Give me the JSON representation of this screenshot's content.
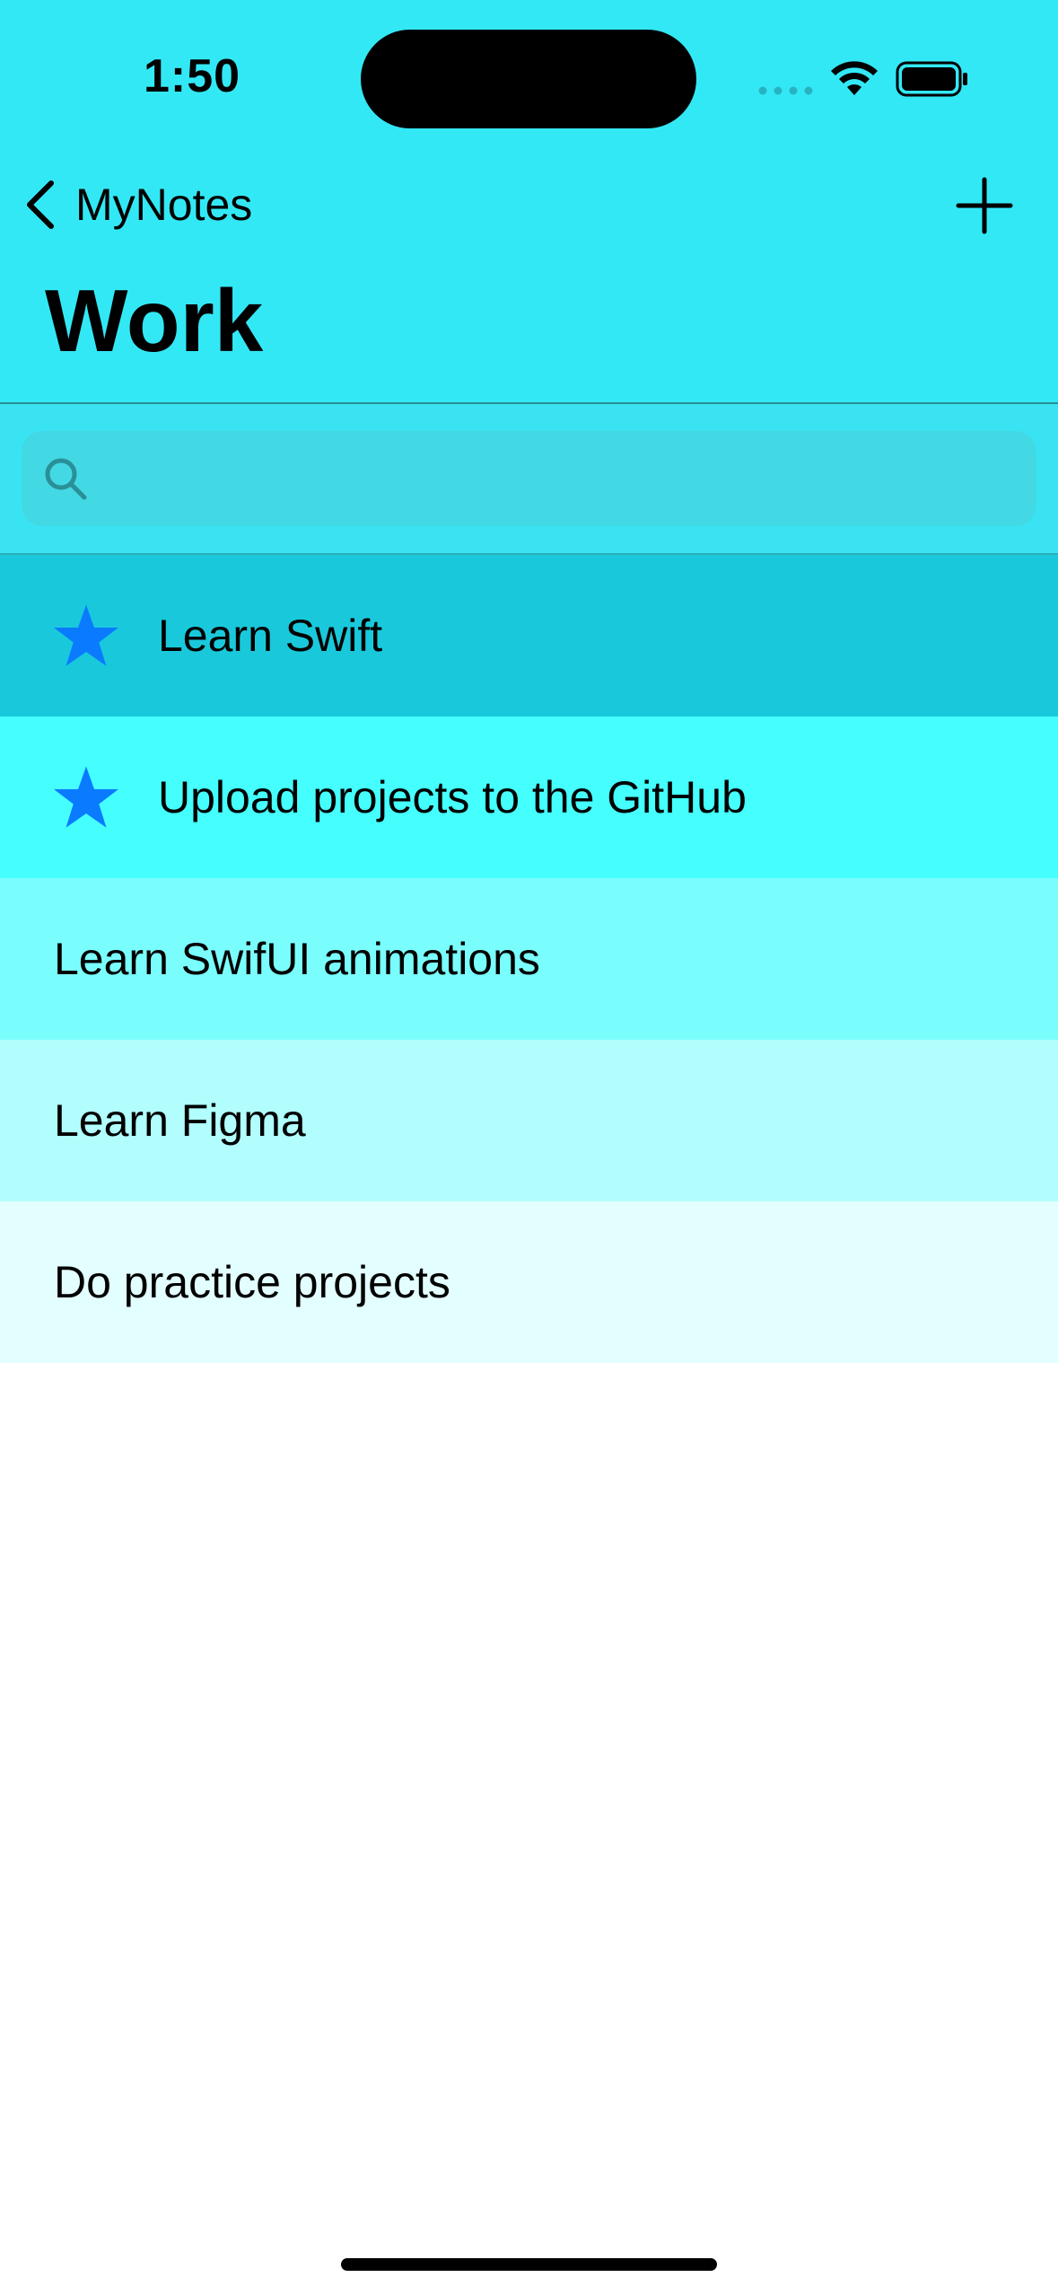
{
  "status_bar": {
    "time": "1:50"
  },
  "nav": {
    "back_label": "MyNotes",
    "title": "Work"
  },
  "search": {
    "placeholder": "",
    "value": ""
  },
  "notes": [
    {
      "label": "Learn Swift",
      "starred": true,
      "background": "#19c9db"
    },
    {
      "label": "Upload projects to the GitHub",
      "starred": true,
      "background": "#44fffe"
    },
    {
      "label": "Learn SwifUI animations",
      "starred": false,
      "background": "#7afefd"
    },
    {
      "label": "Learn Figma",
      "starred": false,
      "background": "#b2fefe"
    },
    {
      "label": "Do practice projects",
      "starred": false,
      "background": "#e3fefe"
    }
  ],
  "colors": {
    "header_background": "#33e8f5",
    "star": "#0a7aff",
    "text": "#000000"
  }
}
